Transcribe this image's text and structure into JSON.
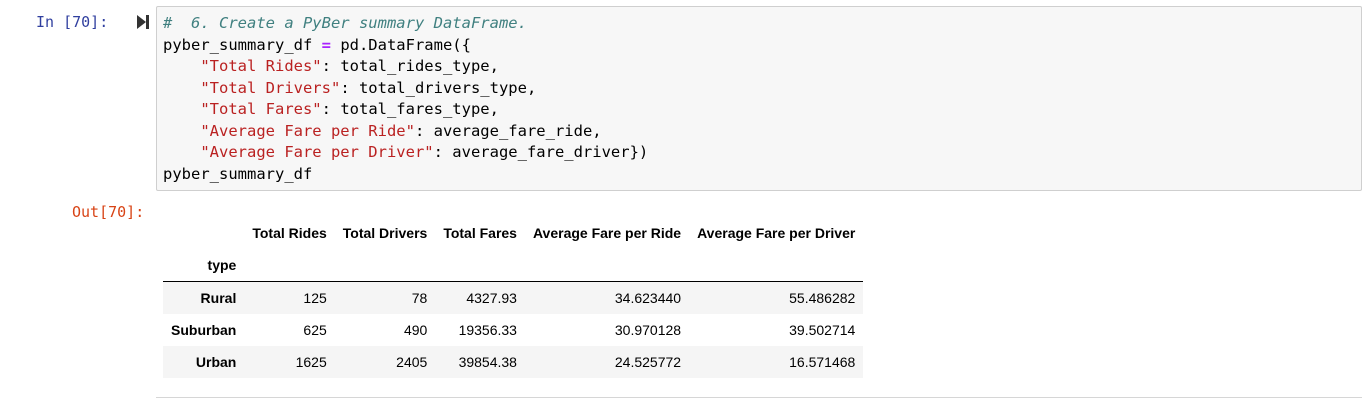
{
  "cell": {
    "in_prompt": "In [70]:",
    "out_prompt": "Out[70]:",
    "run_icon": "run-cell-icon",
    "code_lines": [
      [
        {
          "t": "#  6. Create a PyBer summary DataFrame.",
          "k": "comment"
        }
      ],
      [
        {
          "t": "pyber_summary_df ",
          "k": "plain"
        },
        {
          "t": "=",
          "k": "op"
        },
        {
          "t": " pd.DataFrame({",
          "k": "plain"
        }
      ],
      [
        {
          "t": "    ",
          "k": "plain"
        },
        {
          "t": "\"Total Rides\"",
          "k": "str"
        },
        {
          "t": ": total_rides_type,",
          "k": "plain"
        }
      ],
      [
        {
          "t": "    ",
          "k": "plain"
        },
        {
          "t": "\"Total Drivers\"",
          "k": "str"
        },
        {
          "t": ": total_drivers_type,",
          "k": "plain"
        }
      ],
      [
        {
          "t": "    ",
          "k": "plain"
        },
        {
          "t": "\"Total Fares\"",
          "k": "str"
        },
        {
          "t": ": total_fares_type,",
          "k": "plain"
        }
      ],
      [
        {
          "t": "    ",
          "k": "plain"
        },
        {
          "t": "\"Average Fare per Ride\"",
          "k": "str"
        },
        {
          "t": ": average_fare_ride,",
          "k": "plain"
        }
      ],
      [
        {
          "t": "    ",
          "k": "plain"
        },
        {
          "t": "\"Average Fare per Driver\"",
          "k": "str"
        },
        {
          "t": ": average_fare_driver})",
          "k": "plain"
        }
      ],
      [
        {
          "t": "pyber_summary_df",
          "k": "plain"
        }
      ]
    ]
  },
  "dataframe": {
    "columns": [
      "Total Rides",
      "Total Drivers",
      "Total Fares",
      "Average Fare per Ride",
      "Average Fare per Driver"
    ],
    "index_name": "type",
    "rows": [
      {
        "index": "Rural",
        "values": [
          "125",
          "78",
          "4327.93",
          "34.623440",
          "55.486282"
        ]
      },
      {
        "index": "Suburban",
        "values": [
          "625",
          "490",
          "19356.33",
          "30.970128",
          "39.502714"
        ]
      },
      {
        "index": "Urban",
        "values": [
          "1625",
          "2405",
          "39854.38",
          "24.525772",
          "16.571468"
        ]
      }
    ]
  },
  "colors": {
    "in_prompt": "#303f9f",
    "out_prompt": "#d84315",
    "code_bg": "#f7f7f7",
    "comment": "#408080",
    "string": "#ba2121",
    "operator": "#aa22ff"
  }
}
